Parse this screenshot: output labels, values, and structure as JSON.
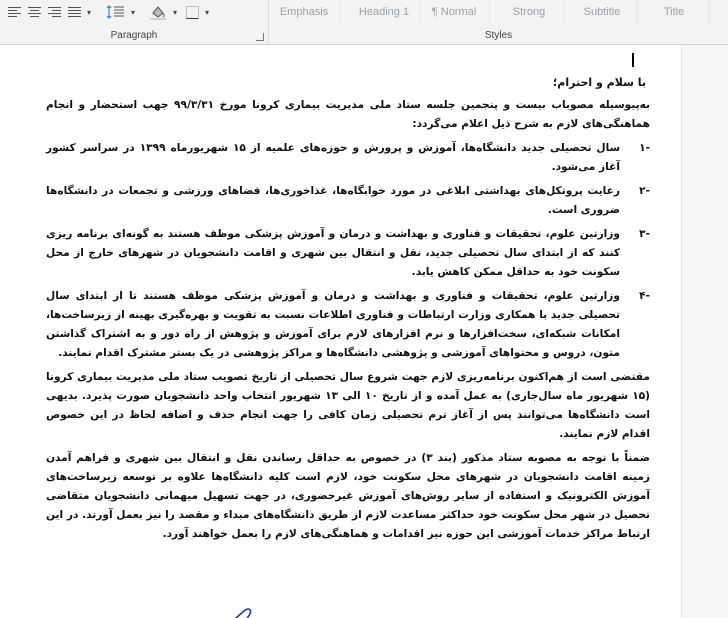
{
  "ribbon": {
    "paragraph_label": "Paragraph",
    "styles_label": "Styles",
    "styles": [
      "Emphasis",
      "Heading 1",
      "¶ Normal",
      "Strong",
      "Subtitle",
      "Title"
    ],
    "icons": [
      "align-left-icon",
      "align-center-icon",
      "align-right-icon",
      "justify-icon",
      "line-spacing-icon",
      "shading-icon",
      "borders-icon",
      "dialog-launcher-icon"
    ]
  },
  "document": {
    "greeting": "با سلام و احترام؛",
    "intro": "بەپیوسیله مصوباب بیست و پنجمین جلسه ستاد ملی مدیریت بیماری کرونا مورخ ۹۹/۳/۳۱ جهب استحضار و انجام هماهنگی‌های لازم به شرح ذیل اعلام می‌گردد:",
    "items": [
      {
        "num": "-۱",
        "text": "سال تحصیلی جدید دانشگاه‌ها، آموزش و پرورش و حوزه‌های علمیه از ۱۵ شهریورماه ۱۳۹۹ در سراسر کشور آغاز می‌شود."
      },
      {
        "num": "-۲",
        "text": "رعایت پروتکل‌های بهداشتی ابلاغی در مورد خوابگاه‌ها، غذاخوری‌ها، فضاهای ورزشی و تجمعات در دانشگاه‌ها ضروری است."
      },
      {
        "num": "-۳",
        "text": "وزارتین علوم، تحقیقات و فناوری و بهداشت و درمان و آموزش پزشکی موظف هستند به گونه‌ای برنامه ریزی کنند که از ابتدای سال تحصیلی جدید، نقل و انتقال بین شهری و اقامت دانشجویان در شهرهای خارج از محل سکونت خود به حداقل ممکن کاهش یابد."
      },
      {
        "num": "-۴",
        "text": "وزارتین علوم، تحقیقات و فناوری و بهداشت و درمان و آموزش پزشکی موظف هستند تا از ابتدای سال تحصیلی جدید با همکاری وزارت ارتباطات و فناوری اطلاعات نسبت به تقویت و بهره‌گیری بهینه از زیرساخت‌ها، امکانات شبکه‌ای، سخت‌افزارها و نرم افزارهای لازم برای آموزش و پژوهش از راه دور و به اشتراک گذاشتن متون، دروس و محتواهای آموزشی و پژوهشی دانشگاه‌ها و مراکز پژوهشی در یک بستر مشترک اقدام نمایند."
      }
    ],
    "para2": "مقتضی است از هم‌اکنون برنامه‌ریزی لازم جهت شروع سال تحصیلی از تاریخ تصویب ستاد ملی مدیریت بیماری کرونا (۱۵ شهریور ماه سال‌جاری) به عمل آمده و از تاریخ ۱۰ الی ۱۳ شهریور انتخاب واحد دانشجویان صورت پذیرد. بدیهی است دانشگاه‌ها می‌توانند پس از آغاز ترم تحصیلی زمان کافی را جهت انجام حذف و اضافه لحاظ در این خصوص اقدام لازم نمایند.",
    "para3": "ضمناً با توجه به مصوبه ستاد مذکور (بند ۳) در خصوص به حداقل رساندن نقل و انتقال بین شهری و فراهم آمدن زمینه اقامت دانشجویان در شهرهای محل سکونت خود، لازم است کلیه دانشگاه‌ها علاوه بر توسعه زیرساخت‌های آموزش الکترونیک و استفاده از سایر روش‌های آموزش غیرحضوری، در جهت تسهیل میهمانی دانشجویان متقاضی تحصیل در شهر محل سکونت خود حداکثر مساعدت لازم از طریق دانشگاه‌های مبداء و مقصد را نیز بعمل آورند. در این ارتباط مراکز خدمات آموزشی این حوزه نیز اقدامات و هماهنگی‌های لازم را بعمل خواهند آورد."
  }
}
